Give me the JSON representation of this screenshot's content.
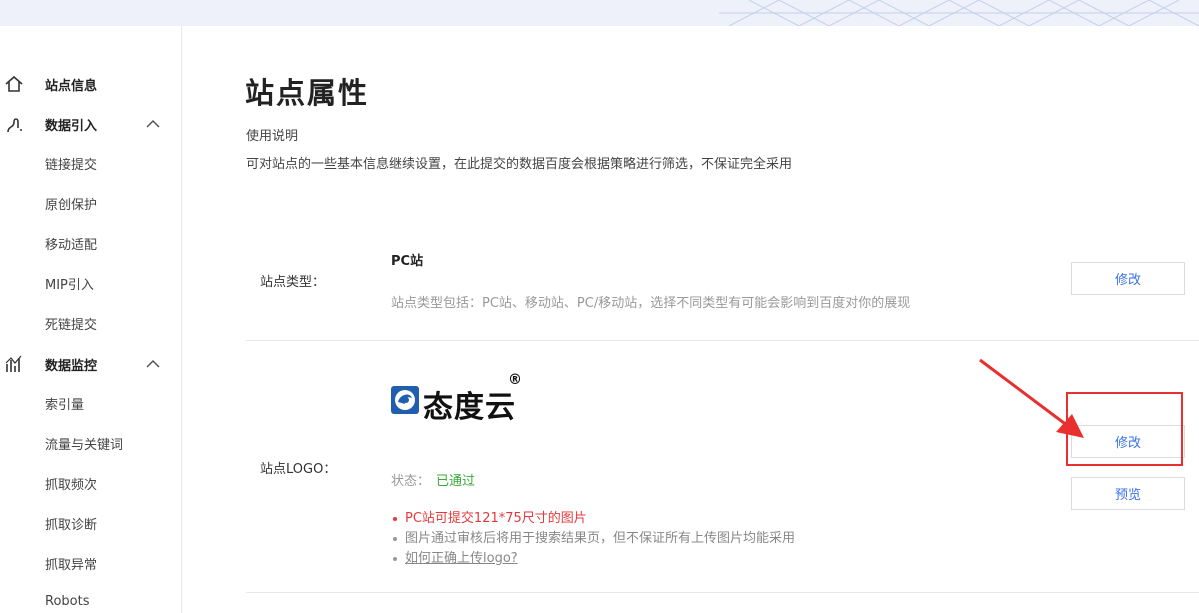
{
  "sidebar": {
    "groups": [
      {
        "label": "站点信息",
        "icon": "home-icon"
      },
      {
        "label": "数据引入",
        "icon": "data-import-icon",
        "chevron": "chevron-up-icon"
      },
      {
        "label": "数据监控",
        "icon": "chart-monitor-icon",
        "chevron": "chevron-up-icon"
      }
    ],
    "import_items": [
      "链接提交",
      "原创保护",
      "移动适配",
      "MIP引入",
      "死链提交"
    ],
    "monitor_items": [
      "索引量",
      "流量与关键词",
      "抓取频次",
      "抓取诊断",
      "抓取异常",
      "Robots"
    ]
  },
  "main": {
    "title": "站点属性",
    "intro_heading": "使用说明",
    "intro_text": "可对站点的一些基本信息继续设置，在此提交的数据百度会根据策略进行筛选，不保证完全采用",
    "site_type": {
      "label": "站点类型：",
      "value": "PC站",
      "description": "站点类型包括：PC站、移动站、PC/移动站，选择不同类型有可能会影响到百度对你的展现",
      "edit_button": "修改"
    },
    "site_logo": {
      "label": "站点LOGO：",
      "logo_text": "态度云",
      "logo_mark": "®",
      "status_key": "状态：",
      "status_value": "已通过",
      "tips": [
        "PC站可提交121*75尺寸的图片",
        "图片通过审核后将用于搜索结果页，但不保证所有上传图片均能采用",
        "如何正确上传logo?"
      ],
      "edit_button": "修改",
      "preview_button": "预览"
    }
  },
  "colors": {
    "accent_blue": "#3a72e8",
    "success_green": "#3aa83a",
    "warning_red": "#e4393c",
    "annotation_red": "#e8312f"
  }
}
